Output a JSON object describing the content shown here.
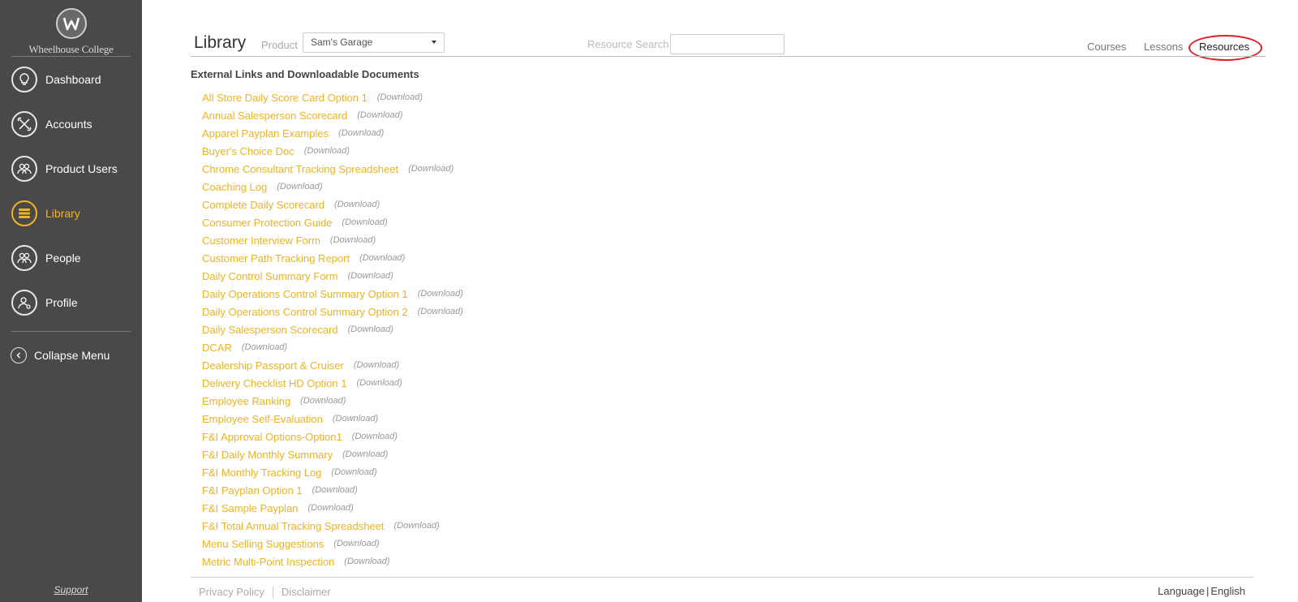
{
  "brand": {
    "name": "Wheelhouse College"
  },
  "sidebar": {
    "items": [
      {
        "label": "Dashboard",
        "icon": "lightbulb-icon"
      },
      {
        "label": "Accounts",
        "icon": "tools-icon"
      },
      {
        "label": "Product Users",
        "icon": "users-icon"
      },
      {
        "label": "Library",
        "icon": "library-icon",
        "active": true
      },
      {
        "label": "People",
        "icon": "people-icon"
      },
      {
        "label": "Profile",
        "icon": "profile-icon"
      }
    ],
    "collapse_label": "Collapse Menu",
    "support_label": "Support"
  },
  "header": {
    "title": "Library",
    "product_label": "Product",
    "product_value": "Sam's Garage",
    "search_label": "Resource Search",
    "search_value": "",
    "tabs": [
      {
        "label": "Courses"
      },
      {
        "label": "Lessons"
      },
      {
        "label": "Resources",
        "active": true
      }
    ]
  },
  "content": {
    "section_title": "External Links and Downloadable Documents",
    "download_label": "(Download)",
    "resources": [
      "All Store Daily Score Card Option 1",
      "Annual Salesperson Scorecard",
      "Apparel Payplan Examples",
      "Buyer's Choice Doc",
      "Chrome Consultant Tracking Spreadsheet",
      "Coaching Log",
      "Complete Daily Scorecard",
      "Consumer Protection Guide",
      "Customer Interview Form",
      "Customer Path Tracking Report",
      "Daily Control Summary Form",
      "Daily Operations Control Summary Option 1",
      "Daily Operations Control Summary Option 2",
      "Daily Salesperson Scorecard",
      "DCAR",
      "Dealership Passport & Cruiser",
      "Delivery Checklist HD Option 1",
      "Employee Ranking",
      "Employee Self-Evaluation",
      "F&I Approval Options-Option1",
      "F&I Daily Monthly Summary",
      "F&I Monthly Tracking Log",
      "F&I Payplan Option 1",
      "F&I Sample Payplan",
      "F&I Total Annual Tracking Spreadsheet",
      "Menu Selling Suggestions",
      "Metric Multi-Point Inspection"
    ]
  },
  "footer": {
    "privacy_label": "Privacy Policy",
    "disclaimer_label": "Disclaimer",
    "language_label": "Language",
    "language_value": "English"
  },
  "colors": {
    "sidebar_bg": "#4a4848",
    "accent": "#f0b323",
    "highlight_circle": "#e0202a"
  }
}
